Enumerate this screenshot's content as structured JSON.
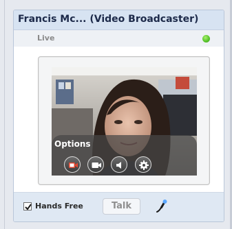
{
  "window": {
    "title": "Francis Mc... (Video Broadcaster)"
  },
  "status": {
    "text": "Live",
    "indicator_color": "#59c52c"
  },
  "video": {
    "options_label": "Options",
    "controls": [
      {
        "icon": "record-icon"
      },
      {
        "icon": "camera-icon"
      },
      {
        "icon": "speaker-icon"
      },
      {
        "icon": "gear-icon"
      }
    ]
  },
  "footer": {
    "hands_free_label": "Hands Free",
    "hands_free_checked": true,
    "talk_label": "Talk",
    "mic_icon": "microphone-icon"
  }
}
